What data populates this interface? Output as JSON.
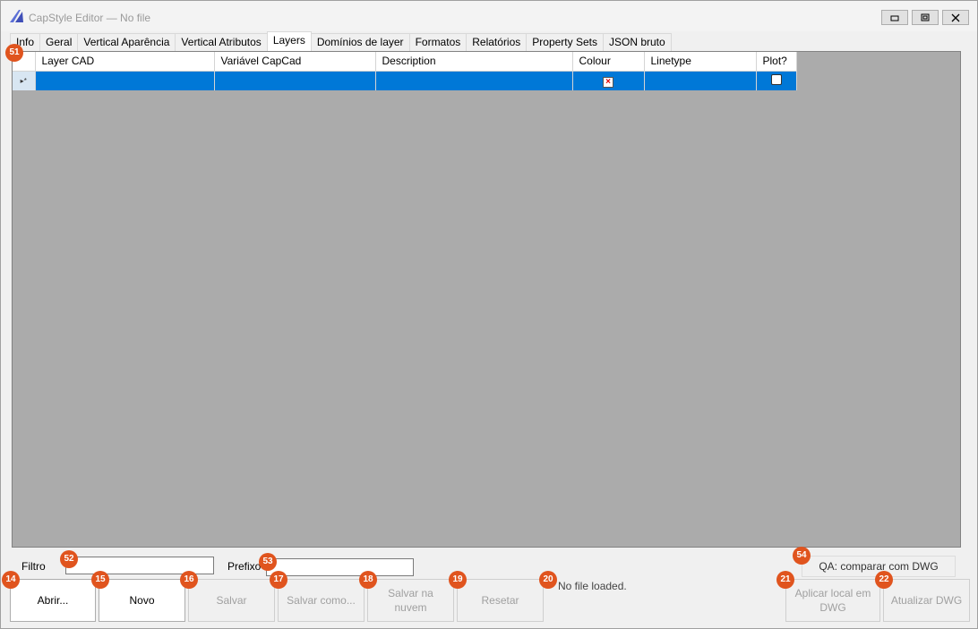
{
  "window": {
    "title": "CapStyle Editor — No file",
    "controls": [
      "minimize",
      "restore",
      "close"
    ]
  },
  "tabs": [
    {
      "label": "Info",
      "active": false
    },
    {
      "label": "Geral",
      "active": false
    },
    {
      "label": "Vertical Aparência",
      "active": false
    },
    {
      "label": "Vertical Atributos",
      "active": false
    },
    {
      "label": "Layers",
      "active": true
    },
    {
      "label": "Domínios de layer",
      "active": false
    },
    {
      "label": "Formatos",
      "active": false
    },
    {
      "label": "Relatórios",
      "active": false
    },
    {
      "label": "Property Sets",
      "active": false
    },
    {
      "label": "JSON bruto",
      "active": false
    }
  ],
  "grid": {
    "columns": [
      "Layer CAD",
      "Variável CapCad",
      "Description",
      "Colour",
      "Linetype",
      "Plot?"
    ],
    "new_row_marker": "▸*",
    "rows": [
      {
        "layer_cad": "",
        "variavel": "",
        "description": "",
        "colour": "×",
        "linetype": "",
        "plot": false
      }
    ],
    "selected_color": "#0078d7",
    "background_color": "#ababab"
  },
  "filters": {
    "filtro_label": "Filtro",
    "filtro_value": "",
    "prefixo_label": "Prefixo",
    "prefixo_value": ""
  },
  "qa_button": "QA: comparar com DWG",
  "buttons": {
    "abrir": "Abrir...",
    "novo": "Novo",
    "salvar": "Salvar",
    "salvar_como": "Salvar como...",
    "salvar_nuvem": "Salvar na nuvem",
    "resetar": "Resetar",
    "aplicar": "Aplicar local em DWG",
    "atualizar": "Atualizar DWG"
  },
  "status": "No file loaded.",
  "badges": {
    "b51": "51",
    "b52": "52",
    "b53": "53",
    "b54": "54",
    "b14": "14",
    "b15": "15",
    "b16": "16",
    "b17": "17",
    "b18": "18",
    "b19": "19",
    "b20": "20",
    "b21": "21",
    "b22": "22"
  }
}
